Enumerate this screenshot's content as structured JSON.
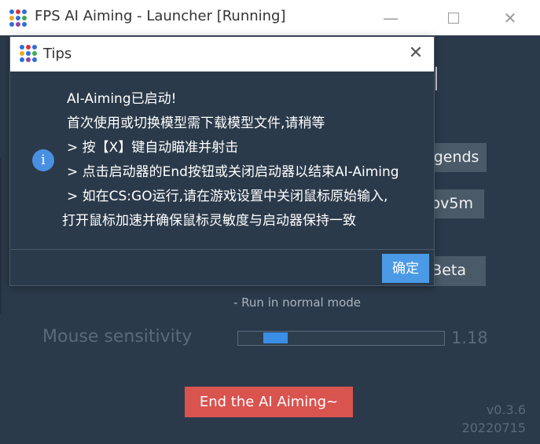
{
  "window": {
    "title": "FPS AI Aiming - Launcher [Running]",
    "min_glyph": "—",
    "close_glyph": "✕"
  },
  "icon": {
    "name": "app-grid-icon",
    "dot_colors": [
      "#2f6fd6",
      "#d9363e",
      "#2f6fd6",
      "#f2a51a",
      "#2f6fd6",
      "#3caa54",
      "#2f6fd6",
      "#8e44ad",
      "#2f6fd6"
    ]
  },
  "background": {
    "button_1": "egends",
    "button_2": "ov5m",
    "button_3": "Beta",
    "mode_text": "- Run in normal mode",
    "sensitivity_label": "Mouse sensitivity",
    "sensitivity_value": "1.18",
    "end_button": "End the AI Aiming~",
    "version": "v0.3.6",
    "build_date": "20220715"
  },
  "dialog": {
    "title": "Tips",
    "close_glyph": "✕",
    "info_glyph": "i",
    "lines": [
      "AI-Aiming已启动!",
      "首次使用或切换模型需下载模型文件,请稍等",
      "> 按【X】键自动瞄准并射击",
      "> 点击启动器的End按钮或关闭启动器以结束AI-Aiming",
      "> 如在CS:GO运行,请在游戏设置中关闭鼠标原始输入,",
      "打开鼠标加速并确保鼠标灵敏度与启动器保持一致"
    ],
    "ok_button": "确定"
  },
  "colors": {
    "background": "#2b3a4a",
    "accent": "#4a9ae6",
    "danger": "#d9534f"
  }
}
